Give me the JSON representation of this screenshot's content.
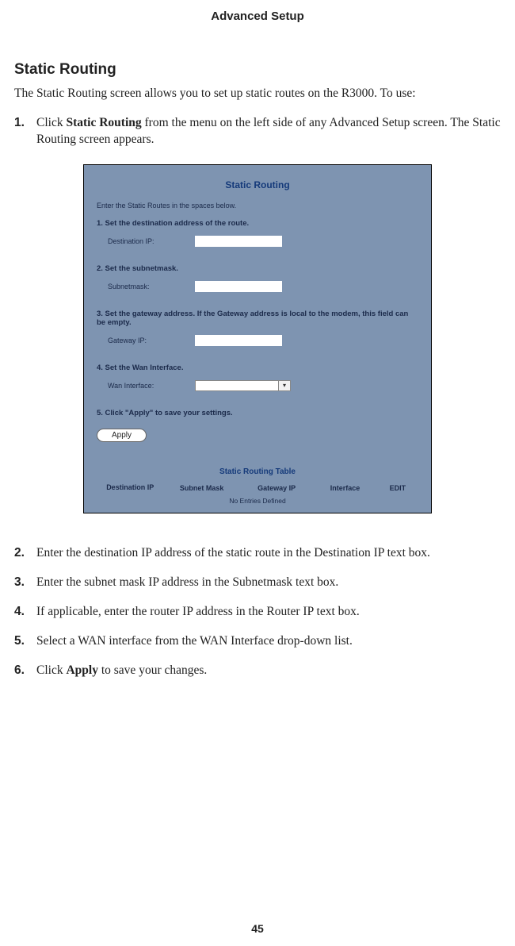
{
  "header": {
    "title": "Advanced Setup"
  },
  "section": {
    "title": "Static Routing"
  },
  "intro": "The Static Routing screen allows you to set up static routes on the R3000. To use:",
  "steps": {
    "s1": {
      "num": "1.",
      "pre": "Click ",
      "bold": "Static Routing",
      "post": " from the menu on the left side of any Advanced Setup screen. The Static Routing screen appears."
    },
    "s2": {
      "num": "2.",
      "text": "Enter the destination IP address of the static route in the Destination IP text box."
    },
    "s3": {
      "num": "3.",
      "text": "Enter the subnet mask IP address in the Subnetmask text box."
    },
    "s4": {
      "num": "4.",
      "text": "If applicable, enter the router IP address in the Router IP text box."
    },
    "s5": {
      "num": "5.",
      "text": "Select a WAN interface from the WAN Interface drop-down list."
    },
    "s6": {
      "num": "6.",
      "pre": "Click ",
      "bold": "Apply",
      "post": " to save your changes."
    }
  },
  "panel": {
    "title": "Static Routing",
    "note": "Enter the Static Routes in the spaces below.",
    "st1": {
      "head": "1. Set the destination address of the route.",
      "label": "Destination IP:",
      "value": ""
    },
    "st2": {
      "head": "2. Set the subnetmask.",
      "label": "Subnetmask:",
      "value": ""
    },
    "st3": {
      "head": "3. Set the gateway address. If the Gateway address is local to the modem, this field can be empty.",
      "label": "Gateway IP:",
      "value": ""
    },
    "st4": {
      "head": "4. Set the Wan Interface.",
      "label": "Wan Interface:",
      "value": ""
    },
    "st5": {
      "head": "5. Click \"Apply\" to save your settings."
    },
    "apply": "Apply",
    "table_title": "Static Routing Table",
    "cols": {
      "c1": "Destination IP",
      "c2": "Subnet Mask",
      "c3": "Gateway IP",
      "c4": "Interface",
      "c5": "EDIT"
    },
    "empty": "No Entries Defined"
  },
  "page_number": "45"
}
